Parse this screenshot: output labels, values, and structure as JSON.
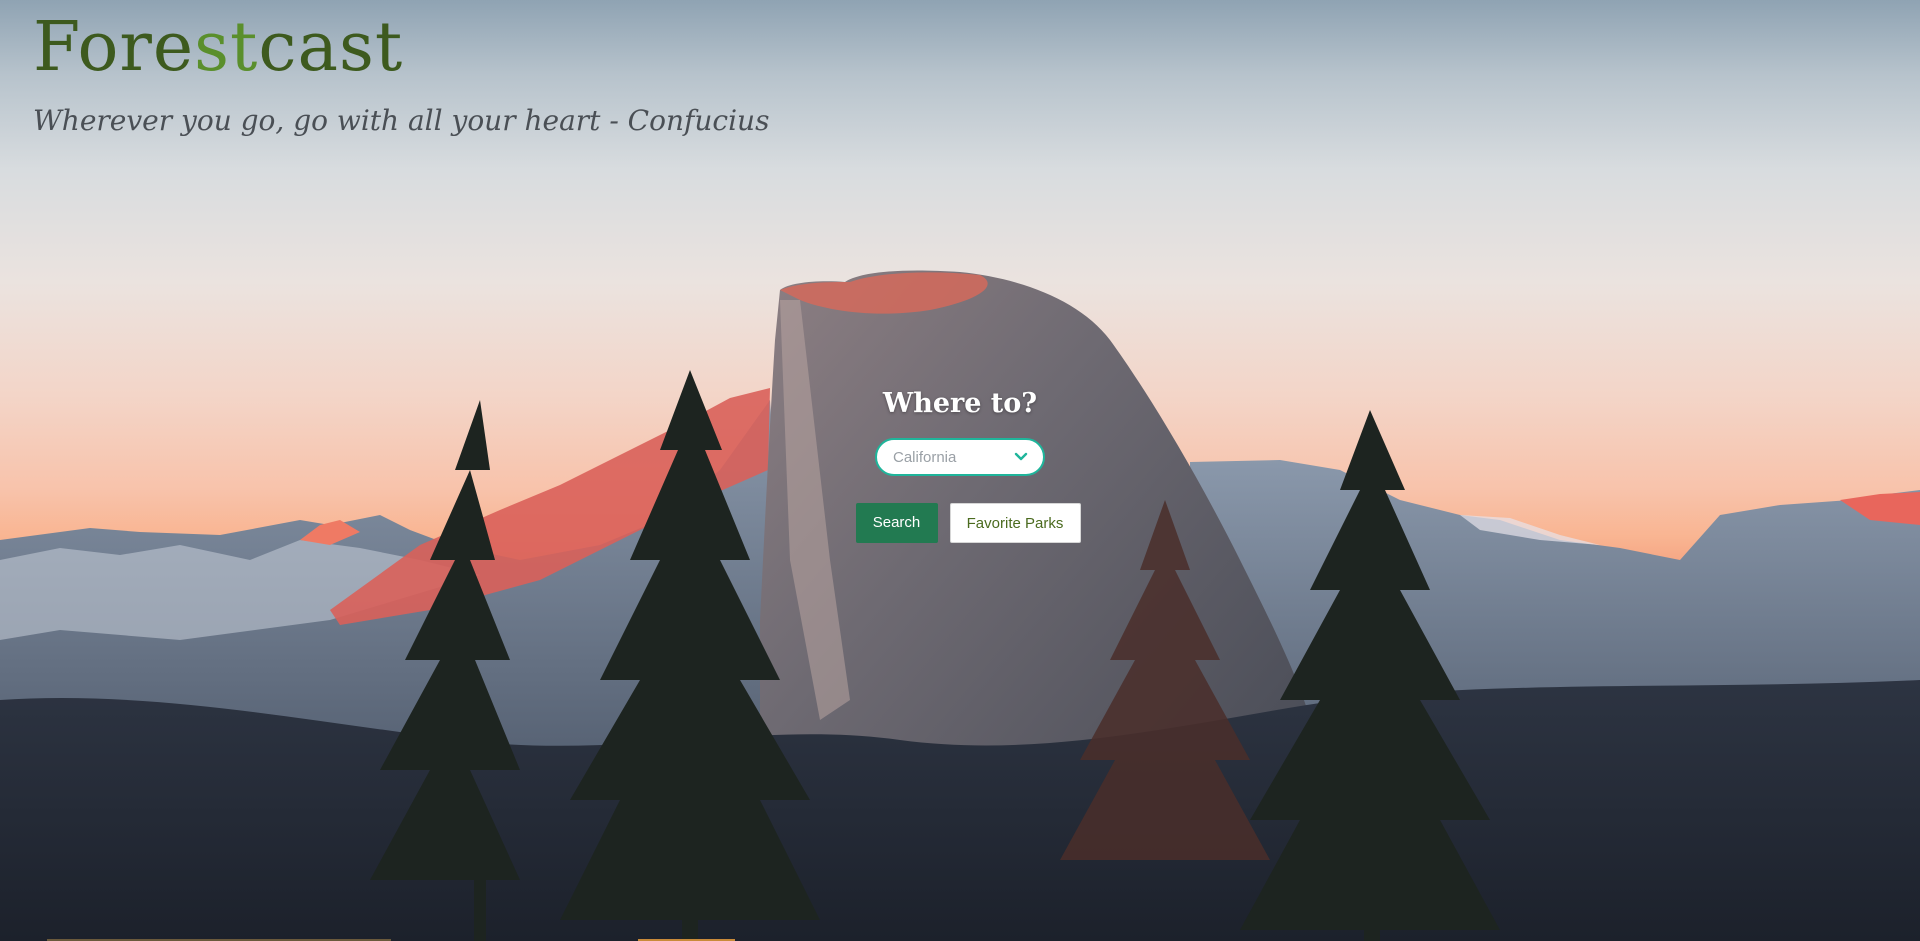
{
  "brand": {
    "part1": "Fore",
    "part2": "st",
    "part3": "cast"
  },
  "tagline": "Wherever you go, go with all your heart - Confucius",
  "search": {
    "heading": "Where to?",
    "state_selected": "California",
    "search_label": "Search",
    "favorites_label": "Favorite Parks"
  },
  "colors": {
    "brand_dark": "#3d5a1e",
    "brand_accent": "#5a8f2c",
    "search_button": "#227a51",
    "select_border": "#1fb59b"
  },
  "icons": {
    "select": "chevron-down-icon"
  },
  "background": "Half Dome at sunset with pine trees"
}
